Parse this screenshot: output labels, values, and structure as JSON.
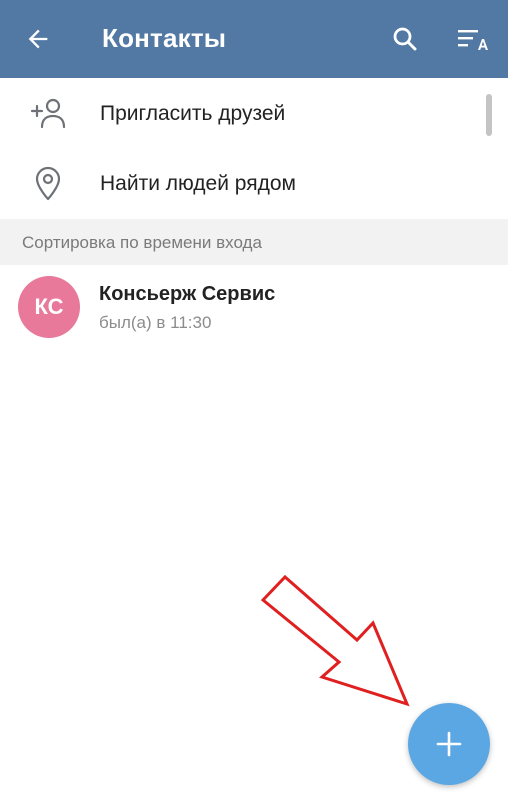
{
  "header": {
    "title": "Контакты",
    "background_color": "#5279a4",
    "back_icon": "arrow-left-icon",
    "search_icon": "search-icon",
    "sort_icon": "sort-alpha-icon"
  },
  "actions": [
    {
      "label": "Пригласить друзей",
      "icon": "add-person-icon"
    },
    {
      "label": "Найти людей рядом",
      "icon": "location-pin-icon"
    }
  ],
  "section": {
    "label": "Сортировка по времени входа"
  },
  "contacts": [
    {
      "initials": "КС",
      "name": "Консьерж Сервис",
      "status": "был(а) в 11:30",
      "avatar_color": "#e8799a"
    }
  ],
  "fab": {
    "icon": "plus-icon",
    "color": "#5aa7e3"
  },
  "annotation": {
    "icon": "red-arrow-icon",
    "color": "#e02020"
  }
}
